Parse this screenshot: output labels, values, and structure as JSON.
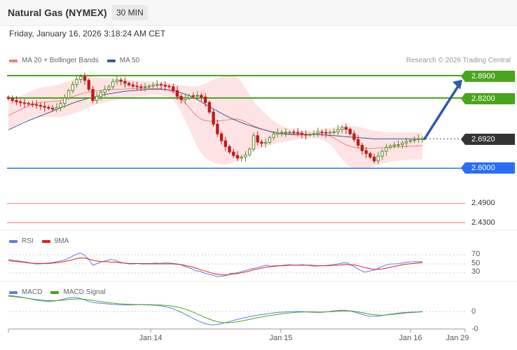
{
  "header": {
    "title": "Natural Gas (NYMEX)",
    "timeframe": "30 MIN",
    "datetime": "Friday, January 16, 2026 3:18:24 AM CET"
  },
  "credit": "Research © 2026 Trading Central",
  "colors": {
    "green": "#4aa51c",
    "blue": "#2a6ef7",
    "red_level": "#f3a3a3",
    "band_fill": "#fde3e3",
    "ma20": "#f08080",
    "ma50": "#3d5a99",
    "bull": "#5b8c2a",
    "bear": "#c21a1a",
    "arrow": "#2f5aa8",
    "rsi": "#5b7fe0",
    "rsi_ma": "#e02020",
    "macd": "#5b7fe0",
    "macd_signal": "#4aa51c"
  },
  "price_legend": [
    {
      "label": "MA 20 + Bollinger Bands",
      "color": "#f08080"
    },
    {
      "label": "MA 50",
      "color": "#3d5a99"
    }
  ],
  "rsi_legend": [
    {
      "label": "RSI",
      "color": "#5b7fe0"
    },
    {
      "label": "9MA",
      "color": "#e02020"
    }
  ],
  "macd_legend": [
    {
      "label": "MACD",
      "color": "#5b7fe0"
    },
    {
      "label": "MACD Signal",
      "color": "#4aa51c"
    }
  ],
  "price_tags": [
    {
      "label": "2.8900",
      "price": 2.89,
      "style": "green"
    },
    {
      "label": "2.8200",
      "price": 2.82,
      "style": "green"
    },
    {
      "label": "2.6920",
      "price": 2.692,
      "style": "dark"
    },
    {
      "label": "2.6000",
      "price": 2.6,
      "style": "blue"
    }
  ],
  "level_labels": [
    {
      "label": "2.4900",
      "price": 2.49
    },
    {
      "label": "2.4300",
      "price": 2.43
    }
  ],
  "rsi_labels": [
    "70",
    "50",
    "30"
  ],
  "macd_labels": [
    "0",
    "-0"
  ],
  "x_labels": [
    "Jan 14",
    "Jan 15",
    "Jan 16",
    "Jan 29"
  ],
  "chart_data": [
    {
      "type": "candlestick",
      "title": "Natural Gas (NYMEX)",
      "timeframe": "30 MIN",
      "levels": [
        {
          "price": 2.89,
          "kind": "resistance"
        },
        {
          "price": 2.82,
          "kind": "resistance"
        },
        {
          "price": 2.692,
          "kind": "last price"
        },
        {
          "price": 2.6,
          "kind": "support"
        },
        {
          "price": 2.49,
          "kind": "target"
        },
        {
          "price": 2.43,
          "kind": "target"
        }
      ],
      "close": [
        2.818,
        2.812,
        2.808,
        2.805,
        2.803,
        2.801,
        2.799,
        2.797,
        2.794,
        2.791,
        2.788,
        2.785,
        2.79,
        2.803,
        2.82,
        2.843,
        2.862,
        2.878,
        2.887,
        2.875,
        2.847,
        2.812,
        2.825,
        2.838,
        2.847,
        2.855,
        2.871,
        2.876,
        2.872,
        2.866,
        2.861,
        2.857,
        2.855,
        2.854,
        2.855,
        2.857,
        2.86,
        2.862,
        2.86,
        2.857,
        2.855,
        2.843,
        2.825,
        2.815,
        2.82,
        2.827,
        2.826,
        2.828,
        2.823,
        2.806,
        2.776,
        2.738,
        2.708,
        2.686,
        2.668,
        2.651,
        2.64,
        2.632,
        2.635,
        2.642,
        2.66,
        2.702,
        2.682,
        2.678,
        2.681,
        2.696,
        2.707,
        2.711,
        2.712,
        2.713,
        2.713,
        2.712,
        2.71,
        2.706,
        2.705,
        2.706,
        2.708,
        2.713,
        2.712,
        2.71,
        2.713,
        2.714,
        2.721,
        2.728,
        2.722,
        2.708,
        2.69,
        2.672,
        2.655,
        2.646,
        2.635,
        2.623,
        2.638,
        2.653,
        2.665,
        2.67,
        2.673,
        2.674,
        2.679,
        2.684,
        2.687,
        2.69,
        2.692,
        2.692
      ],
      "bb_upper": [
        2.81,
        2.815,
        2.82,
        2.826,
        2.832,
        2.838,
        2.844,
        2.849,
        2.852,
        2.854,
        2.856,
        2.858,
        2.86,
        2.863,
        2.868,
        2.873,
        2.878,
        2.882,
        2.885,
        2.887,
        2.888,
        2.887,
        2.885,
        2.883,
        2.882,
        2.881,
        2.881,
        2.88,
        2.879,
        2.878,
        2.877,
        2.876,
        2.875,
        2.874,
        2.873,
        2.872,
        2.871,
        2.87,
        2.869,
        2.868,
        2.866,
        2.864,
        2.862,
        2.86,
        2.858,
        2.857,
        2.856,
        2.857,
        2.86,
        2.865,
        2.871,
        2.877,
        2.882,
        2.886,
        2.889,
        2.891,
        2.89,
        2.884,
        2.87,
        2.85,
        2.83,
        2.81,
        2.795,
        2.782,
        2.77,
        2.758,
        2.748,
        2.74,
        2.733,
        2.728,
        2.724,
        2.721,
        2.719,
        2.718,
        2.717,
        2.717,
        2.718,
        2.72,
        2.722,
        2.724,
        2.726,
        2.728,
        2.73,
        2.732,
        2.733,
        2.733,
        2.732,
        2.73,
        2.727,
        2.724,
        2.721,
        2.718,
        2.716,
        2.714,
        2.713,
        2.712,
        2.712,
        2.712,
        2.712,
        2.712,
        2.712,
        2.712,
        2.712,
        2.712
      ],
      "bb_lower": [
        2.72,
        2.728,
        2.735,
        2.742,
        2.748,
        2.752,
        2.756,
        2.758,
        2.76,
        2.761,
        2.761,
        2.76,
        2.76,
        2.761,
        2.763,
        2.766,
        2.77,
        2.775,
        2.78,
        2.785,
        2.79,
        2.795,
        2.8,
        2.803,
        2.806,
        2.809,
        2.812,
        2.814,
        2.816,
        2.818,
        2.82,
        2.822,
        2.824,
        2.826,
        2.827,
        2.828,
        2.829,
        2.829,
        2.828,
        2.826,
        2.822,
        2.812,
        2.796,
        2.775,
        2.75,
        2.722,
        2.693,
        2.667,
        2.647,
        2.633,
        2.624,
        2.618,
        2.614,
        2.612,
        2.612,
        2.614,
        2.618,
        2.624,
        2.632,
        2.64,
        2.648,
        2.654,
        2.66,
        2.665,
        2.669,
        2.672,
        2.675,
        2.678,
        2.681,
        2.684,
        2.686,
        2.688,
        2.69,
        2.691,
        2.692,
        2.693,
        2.693,
        2.692,
        2.689,
        2.684,
        2.675,
        2.662,
        2.645,
        2.628,
        2.614,
        2.605,
        2.6,
        2.598,
        2.598,
        2.6,
        2.603,
        2.607,
        2.611,
        2.615,
        2.618,
        2.62,
        2.622,
        2.623,
        2.624,
        2.625,
        2.626,
        2.627,
        2.628,
        2.628
      ],
      "ma50": [
        2.72,
        2.726,
        2.732,
        2.738,
        2.744,
        2.749,
        2.754,
        2.759,
        2.764,
        2.769,
        2.774,
        2.779,
        2.784,
        2.789,
        2.794,
        2.799,
        2.804,
        2.808,
        2.812,
        2.816,
        2.819,
        2.822,
        2.825,
        2.828,
        2.831,
        2.833,
        2.835,
        2.837,
        2.839,
        2.841,
        2.842,
        2.843,
        2.844,
        2.845,
        2.846,
        2.847,
        2.847,
        2.847,
        2.847,
        2.846,
        2.845,
        2.843,
        2.84,
        2.836,
        2.832,
        2.827,
        2.821,
        2.815,
        2.808,
        2.8,
        2.793,
        2.786,
        2.779,
        2.772,
        2.765,
        2.759,
        2.753,
        2.748,
        2.743,
        2.738,
        2.734,
        2.73,
        2.726,
        2.722,
        2.719,
        2.716,
        2.713,
        2.711,
        2.709,
        2.708,
        2.707,
        2.706,
        2.706,
        2.706,
        2.706,
        2.706,
        2.706,
        2.706,
        2.705,
        2.704,
        2.703,
        2.702,
        2.701,
        2.7,
        2.699,
        2.698,
        2.697,
        2.696,
        2.695,
        2.694,
        2.693,
        2.692,
        2.692,
        2.692,
        2.692,
        2.692,
        2.692,
        2.692,
        2.692,
        2.692,
        2.692,
        2.692,
        2.692,
        2.692
      ],
      "projection": {
        "from": 2.692,
        "to": 2.877
      }
    },
    {
      "type": "line",
      "title": "RSI",
      "levels": [
        70,
        50,
        30
      ],
      "series": [
        {
          "name": "RSI",
          "values": [
            60,
            58,
            57,
            55,
            54,
            52,
            50,
            50,
            51,
            52,
            53,
            55,
            57,
            60,
            65,
            70,
            74,
            70,
            60,
            47,
            51,
            55,
            57,
            60,
            58,
            54,
            52,
            50,
            50,
            51,
            51,
            51,
            51,
            52,
            51,
            52,
            52,
            51,
            50,
            47,
            43,
            40,
            35,
            34,
            30,
            27,
            25,
            22,
            23,
            25,
            29,
            30,
            32,
            35,
            38,
            40,
            42,
            45,
            47,
            45,
            46,
            46,
            47,
            48,
            47,
            47,
            48,
            47,
            46,
            45,
            46,
            46,
            47,
            48,
            50,
            52,
            53,
            47,
            42,
            36,
            32,
            34,
            36,
            40,
            45,
            48,
            50,
            50,
            51,
            53,
            54,
            55,
            55,
            55
          ],
          "note_unused": null
        },
        {
          "name": "9MA",
          "values": [
            57,
            56,
            55,
            54,
            53,
            52,
            51,
            51,
            51,
            51,
            52,
            53,
            54,
            56,
            58,
            61,
            63,
            63,
            61,
            58,
            56,
            55,
            55,
            54,
            54,
            53,
            52,
            51,
            51,
            51,
            50,
            50,
            50,
            50,
            50,
            50,
            50,
            50,
            49,
            48,
            46,
            44,
            41,
            38,
            35,
            32,
            29,
            27,
            26,
            26,
            27,
            28,
            30,
            32,
            34,
            37,
            39,
            41,
            43,
            44,
            45,
            46,
            46,
            47,
            47,
            47,
            47,
            47,
            47,
            46,
            46,
            46,
            46,
            47,
            47,
            48,
            49,
            48,
            47,
            45,
            42,
            40,
            38,
            38,
            39,
            41,
            43,
            45,
            47,
            49,
            50,
            51,
            52,
            53
          ]
        }
      ]
    },
    {
      "type": "line",
      "title": "MACD",
      "series": [
        {
          "name": "MACD",
          "values": [
            1.0,
            0.97,
            0.93,
            0.88,
            0.82,
            0.76,
            0.7,
            0.66,
            0.63,
            0.63,
            0.66,
            0.72,
            0.8,
            0.86,
            0.88,
            0.82,
            0.72,
            0.62,
            0.55,
            0.52,
            0.5,
            0.47,
            0.44,
            0.42,
            0.41,
            0.4,
            0.41,
            0.42,
            0.42,
            0.41,
            0.4,
            0.38,
            0.35,
            0.3,
            0.22,
            0.12,
            0.0,
            -0.15,
            -0.3,
            -0.45,
            -0.6,
            -0.72,
            -0.8,
            -0.83,
            -0.8,
            -0.74,
            -0.66,
            -0.58,
            -0.5,
            -0.43,
            -0.36,
            -0.3,
            -0.25,
            -0.2,
            -0.16,
            -0.12,
            -0.08,
            -0.05,
            -0.03,
            -0.01,
            0.0,
            0.0,
            -0.01,
            -0.03,
            -0.05,
            -0.06,
            -0.05,
            -0.02,
            0.02,
            0.06,
            0.08,
            0.07,
            0.02,
            -0.06,
            -0.15,
            -0.24,
            -0.29,
            -0.3,
            -0.27,
            -0.23,
            -0.18,
            -0.14,
            -0.1,
            -0.07,
            -0.05,
            -0.03,
            -0.02,
            0.0
          ]
        },
        {
          "name": "MACD Signal",
          "values": [
            0.95,
            0.93,
            0.9,
            0.86,
            0.82,
            0.78,
            0.74,
            0.7,
            0.68,
            0.67,
            0.67,
            0.69,
            0.72,
            0.75,
            0.78,
            0.78,
            0.76,
            0.72,
            0.68,
            0.63,
            0.59,
            0.55,
            0.52,
            0.49,
            0.47,
            0.45,
            0.44,
            0.43,
            0.43,
            0.42,
            0.42,
            0.41,
            0.4,
            0.38,
            0.35,
            0.3,
            0.24,
            0.16,
            0.06,
            -0.06,
            -0.19,
            -0.32,
            -0.45,
            -0.56,
            -0.64,
            -0.69,
            -0.7,
            -0.68,
            -0.64,
            -0.59,
            -0.53,
            -0.47,
            -0.41,
            -0.35,
            -0.3,
            -0.25,
            -0.2,
            -0.16,
            -0.12,
            -0.09,
            -0.06,
            -0.04,
            -0.03,
            -0.02,
            -0.02,
            -0.03,
            -0.03,
            -0.02,
            -0.01,
            0.01,
            0.03,
            0.04,
            0.03,
            0.0,
            -0.05,
            -0.11,
            -0.17,
            -0.21,
            -0.23,
            -0.22,
            -0.2,
            -0.17,
            -0.14,
            -0.11,
            -0.08,
            -0.06,
            -0.04,
            -0.02
          ]
        }
      ]
    }
  ]
}
